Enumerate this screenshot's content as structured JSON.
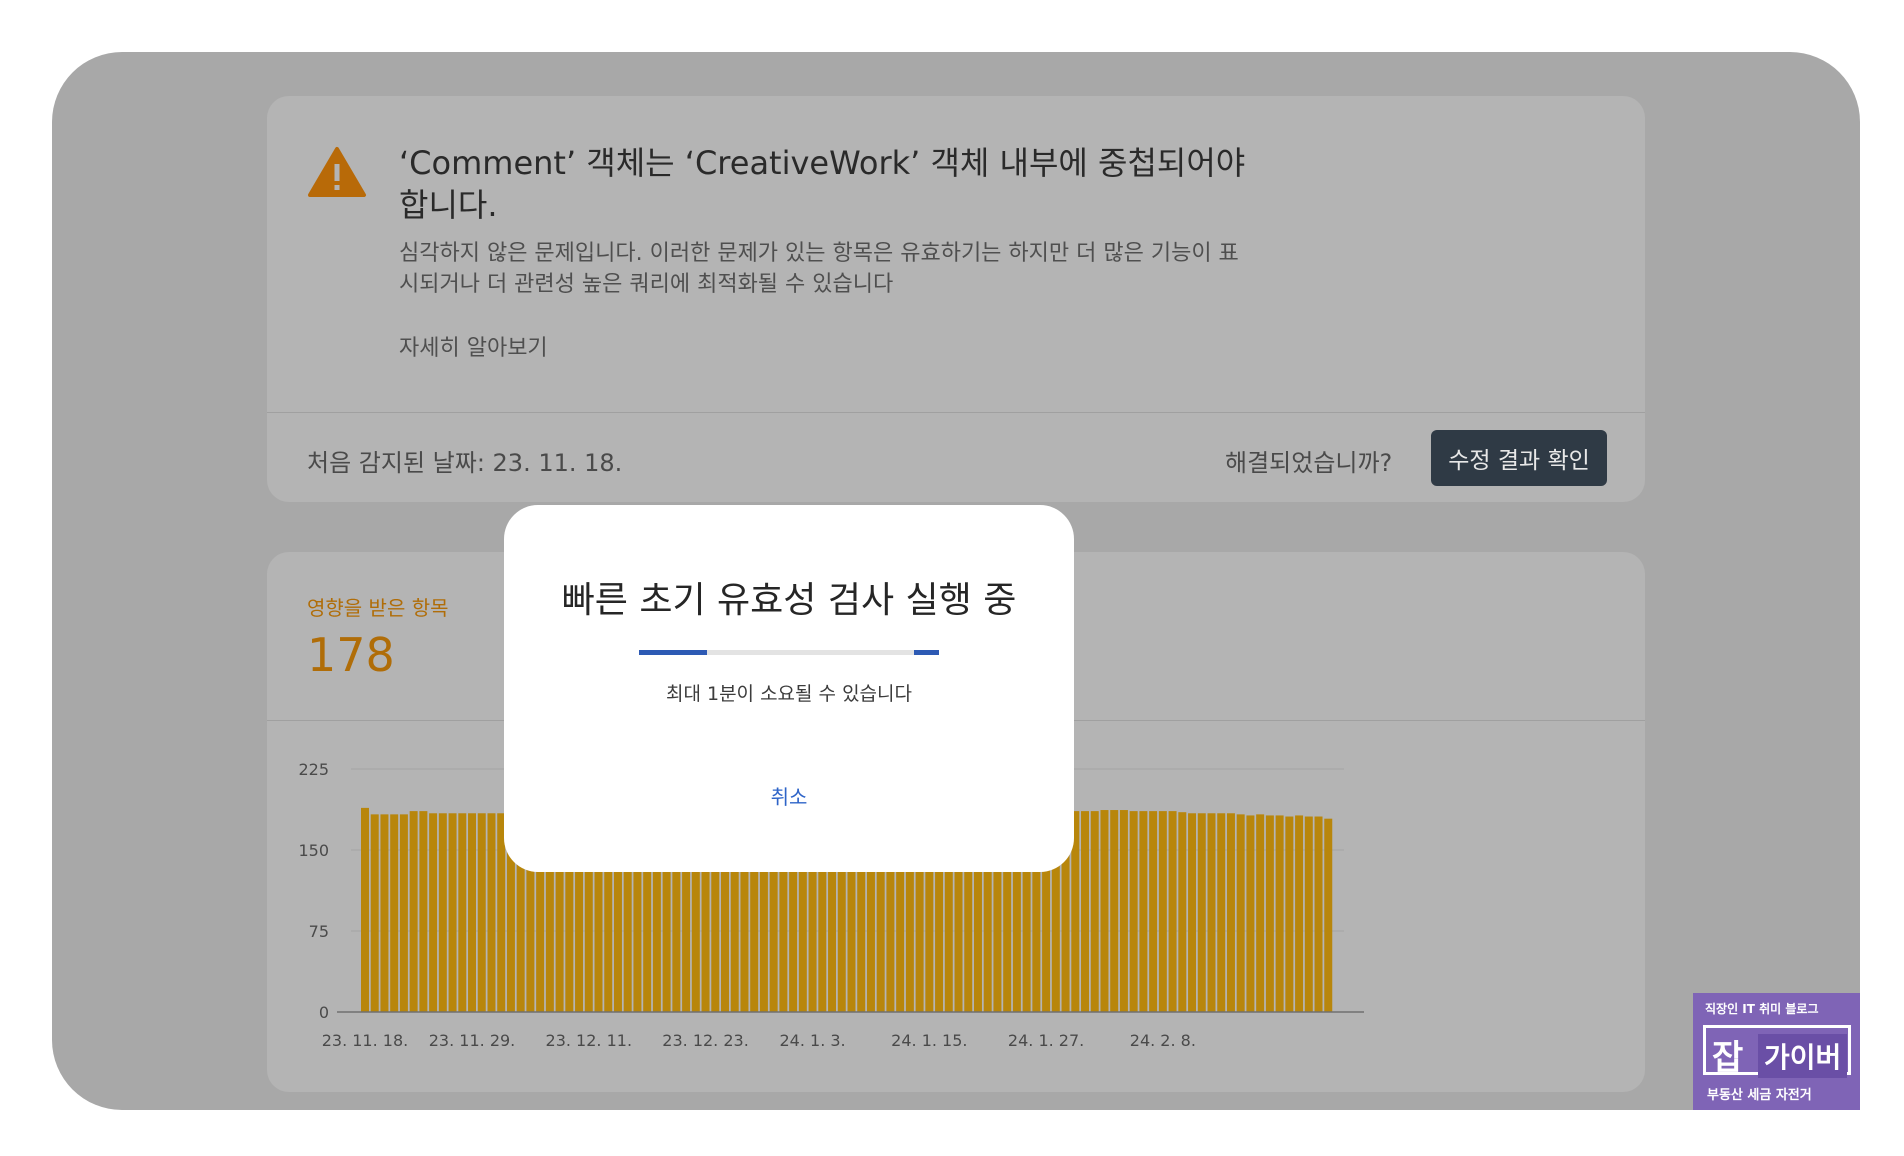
{
  "issue": {
    "title": "‘Comment’ 객체는 ‘CreativeWork’ 객체 내부에 중첩되어야 합니다.",
    "description": "심각하지 않은 문제입니다. 이러한 문제가 있는 항목은 유효하기는 하지만 더 많은 기능이 표시되거나 더 관련성 높은 쿼리에 최적화될 수 있습니다",
    "learn_more": "자세히 알아보기",
    "first_detected": "처음 감지된 날짜: 23. 11. 18.",
    "resolved_question": "해결되었습니까?",
    "validate_button": "수정 결과 확인",
    "warning_icon_color": "#b86a08"
  },
  "affected": {
    "label": "영향을 받은 항목",
    "count": "178",
    "accent_color": "#b06d08"
  },
  "chart_data": {
    "type": "bar",
    "color": "#b8860b",
    "ylim": [
      0,
      225
    ],
    "yticks": [
      "225",
      "150",
      "75",
      "0"
    ],
    "ytick_values": [
      225,
      150,
      75,
      0
    ],
    "xtick_labels": [
      "23. 11. 18.",
      "23. 11. 29.",
      "23. 12. 11.",
      "23. 12. 23.",
      "24. 1. 3.",
      "24. 1. 15.",
      "24. 1. 27.",
      "24. 2. 8."
    ],
    "xtick_indices": [
      0,
      11,
      23,
      35,
      46,
      58,
      70,
      82
    ],
    "values": [
      189,
      183,
      183,
      183,
      183,
      186,
      186,
      184,
      184,
      184,
      184,
      184,
      184,
      184,
      184,
      184,
      184,
      184,
      184,
      184,
      184,
      184,
      184,
      184,
      184,
      184,
      184,
      184,
      184,
      184,
      184,
      184,
      184,
      184,
      184,
      184,
      184,
      184,
      184,
      184,
      184,
      184,
      184,
      184,
      184,
      184,
      184,
      184,
      184,
      184,
      184,
      185,
      185,
      186,
      186,
      186,
      185,
      185,
      184,
      184,
      184,
      184,
      184,
      184,
      184,
      183,
      184,
      183,
      185,
      185,
      186,
      186,
      186,
      186,
      186,
      186,
      187,
      187,
      187,
      186,
      186,
      186,
      186,
      186,
      185,
      184,
      184,
      184,
      184,
      184,
      183,
      182,
      183,
      182,
      182,
      181,
      182,
      181,
      181,
      179
    ]
  },
  "dialog": {
    "title": "빠른 초기 유효성 검사 실행 중",
    "note": "최대 1분이 소요될 수 있습니다",
    "cancel": "취소",
    "progress_color": "#2d5ab4"
  },
  "badge": {
    "top": "직장인 IT 취미 블로그",
    "char": "잡",
    "name": "가이버",
    "bottom": "부동산 세금 자전거"
  }
}
